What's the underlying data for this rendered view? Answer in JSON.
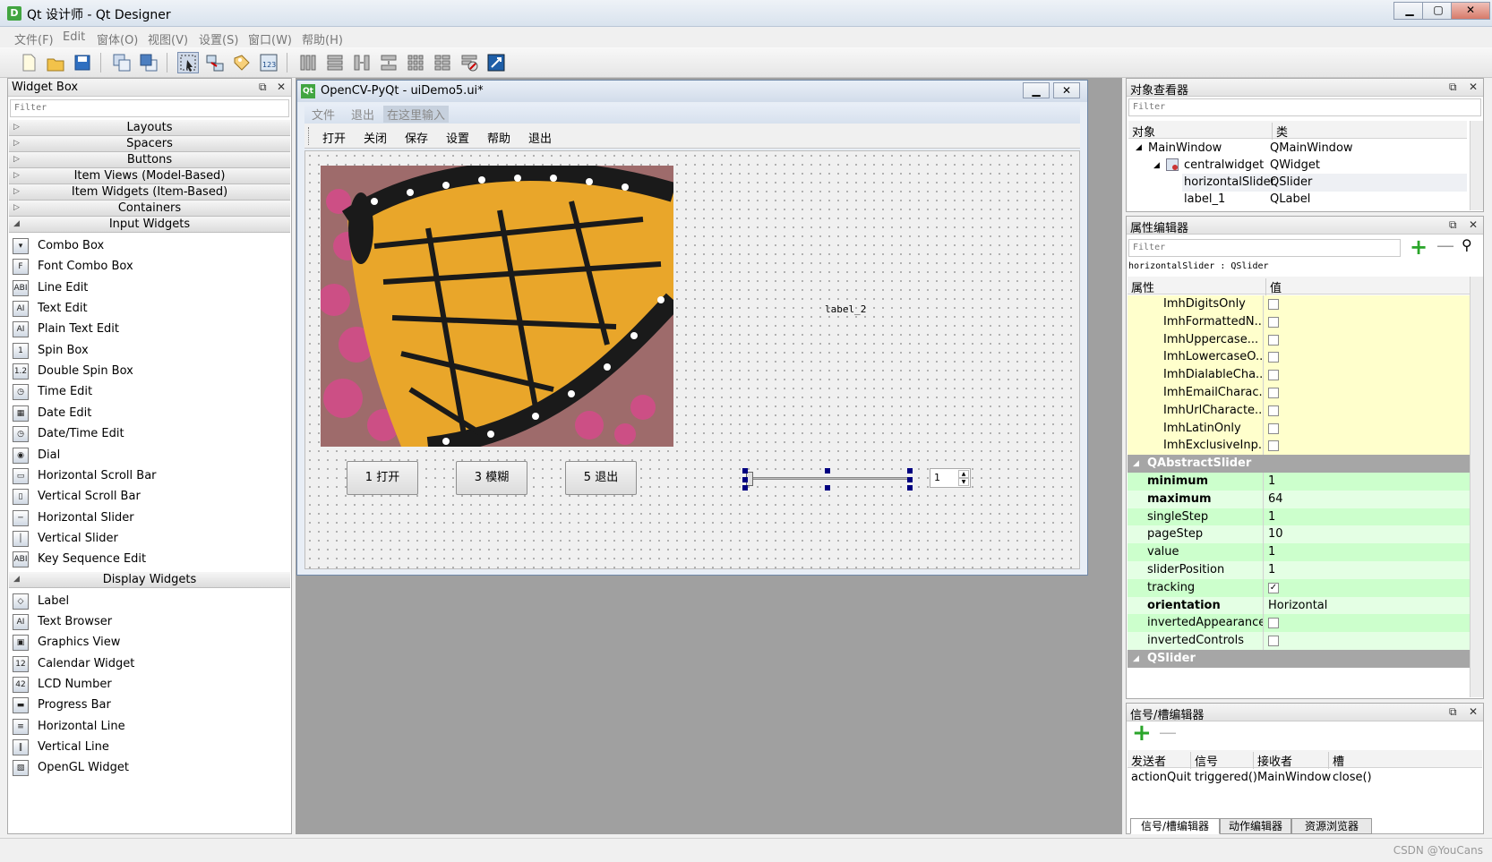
{
  "window": {
    "title": "Qt 设计师 - Qt Designer",
    "icon": "D"
  },
  "menubar": [
    "文件(F)",
    "Edit",
    "窗体(O)",
    "视图(V)",
    "设置(S)",
    "窗口(W)",
    "帮助(H)"
  ],
  "toolbar": [
    "new-file-icon",
    "open-file-icon",
    "save-file-icon",
    "send-to-back-icon",
    "bring-to-front-icon",
    "edit-widgets-icon",
    "edit-signals-slots-icon",
    "edit-buddies-icon",
    "edit-tab-order-icon",
    "layout-horizontal-icon",
    "layout-vertical-icon",
    "layout-h-splitter-icon",
    "layout-v-splitter-icon",
    "layout-grid-icon",
    "layout-form-icon",
    "break-layout-icon",
    "adjust-size-icon"
  ],
  "widget_box": {
    "title": "Widget Box",
    "filter_placeholder": "Filter",
    "categories_top": [
      "Layouts",
      "Spacers",
      "Buttons",
      "Item Views (Model-Based)",
      "Item Widgets (Item-Based)",
      "Containers",
      "Input Widgets"
    ],
    "input_widgets": [
      "Combo Box",
      "Font Combo Box",
      "Line Edit",
      "Text Edit",
      "Plain Text Edit",
      "Spin Box",
      "Double Spin Box",
      "Time Edit",
      "Date Edit",
      "Date/Time Edit",
      "Dial",
      "Horizontal Scroll Bar",
      "Vertical Scroll Bar",
      "Horizontal Slider",
      "Vertical Slider",
      "Key Sequence Edit"
    ],
    "display_category": "Display Widgets",
    "display_widgets": [
      "Label",
      "Text Browser",
      "Graphics View",
      "Calendar Widget",
      "LCD Number",
      "Progress Bar",
      "Horizontal Line",
      "Vertical Line",
      "OpenGL Widget"
    ],
    "input_icon_text": [
      "▾",
      "F",
      "ABI",
      "AI",
      "AI",
      "1",
      "1.2",
      "◷",
      "▦",
      "◷",
      "◉",
      "▭",
      "▯",
      "─",
      "│",
      "ABI"
    ],
    "display_icon_text": [
      "◇",
      "AI",
      "▣",
      "12",
      "42",
      "▬",
      "≡",
      "‖",
      "▧"
    ]
  },
  "form": {
    "title": "OpenCV-PyQt - uiDemo5.ui*",
    "menu": [
      "文件",
      "退出",
      "在这里输入"
    ],
    "toolbar": [
      "打开",
      "关闭",
      "保存",
      "设置",
      "帮助",
      "退出"
    ],
    "label2": "label_2",
    "buttons": [
      "1 打开",
      "3 模糊",
      "5 退出"
    ],
    "spin_value": "1"
  },
  "object_inspector": {
    "title": "对象查看器",
    "filter_placeholder": "Filter",
    "headers": [
      "对象",
      "类"
    ],
    "rows": [
      {
        "obj": "MainWindow",
        "cls": "QMainWindow"
      },
      {
        "obj": "centralwidget",
        "cls": "QWidget"
      },
      {
        "obj": "horizontalSlider",
        "cls": "QSlider"
      },
      {
        "obj": "label_1",
        "cls": "QLabel"
      }
    ]
  },
  "property_editor": {
    "title": "属性编辑器",
    "filter_placeholder": "Filter",
    "object_line": "horizontalSlider : QSlider",
    "headers": [
      "属性",
      "值"
    ],
    "imh": [
      "ImhDigitsOnly",
      "ImhFormattedN...",
      "ImhUppercase...",
      "ImhLowercaseO...",
      "ImhDialableCha...",
      "ImhEmailCharac...",
      "ImhUrlCharacte...",
      "ImhLatinOnly",
      "ImhExclusiveInp..."
    ],
    "group1": "QAbstractSlider",
    "props": [
      {
        "name": "minimum",
        "value": "1"
      },
      {
        "name": "maximum",
        "value": "64"
      },
      {
        "name": "singleStep",
        "value": "1"
      },
      {
        "name": "pageStep",
        "value": "10"
      },
      {
        "name": "value",
        "value": "1"
      },
      {
        "name": "sliderPosition",
        "value": "1"
      },
      {
        "name": "tracking",
        "value": "✓"
      },
      {
        "name": "orientation",
        "value": "Horizontal"
      },
      {
        "name": "invertedAppearance",
        "value": ""
      },
      {
        "name": "invertedControls",
        "value": ""
      }
    ],
    "group2": "QSlider"
  },
  "signal_editor": {
    "title": "信号/槽编辑器",
    "headers": [
      "发送者",
      "信号",
      "接收者",
      "槽"
    ],
    "row": [
      "actionQuit",
      "triggered()",
      "MainWindow",
      "close()"
    ],
    "tabs": [
      "信号/槽编辑器",
      "动作编辑器",
      "资源浏览器"
    ]
  },
  "watermark": "CSDN @YouCans"
}
